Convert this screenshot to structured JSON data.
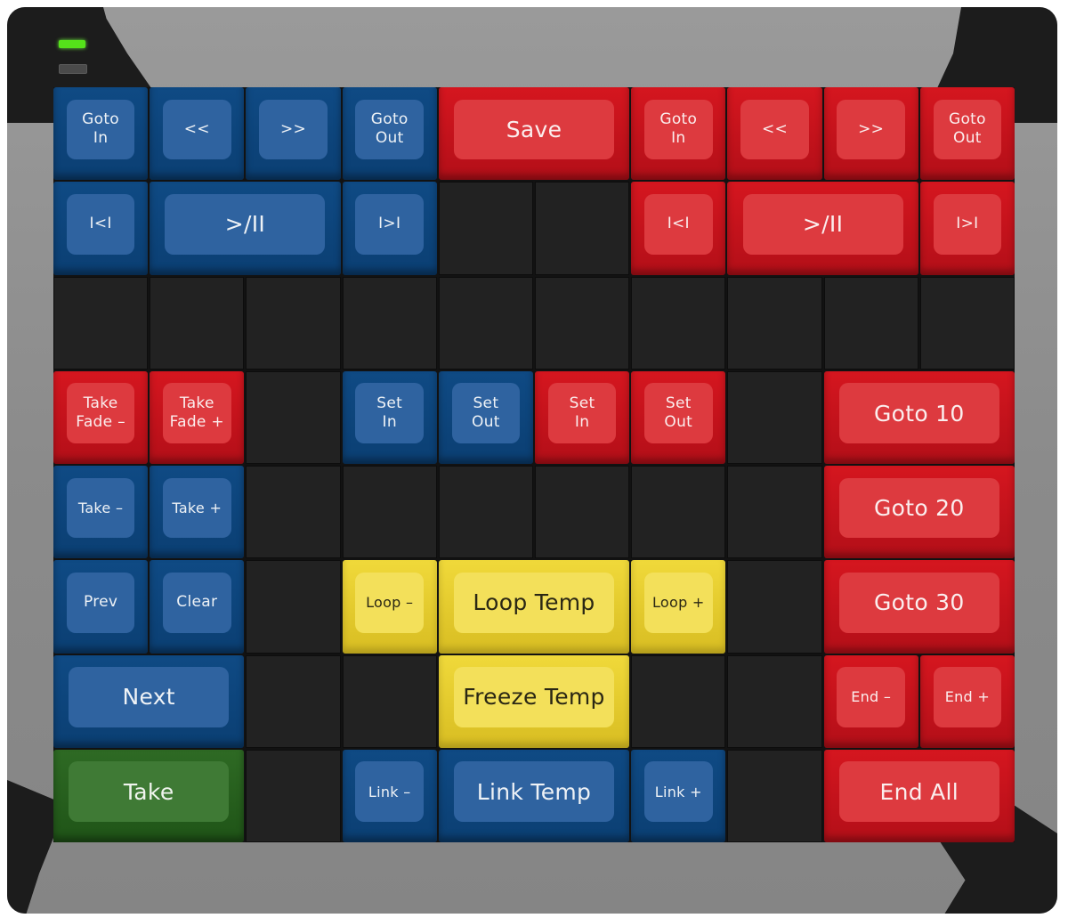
{
  "device": {
    "leds": [
      {
        "name": "power-led",
        "state": "on",
        "color": "#55e21a"
      },
      {
        "name": "status-led",
        "state": "off",
        "color": "#4a4a4a"
      }
    ],
    "colors": {
      "blue": "#2f63a0",
      "red": "#dd3a3f",
      "yellow": "#f3e05a",
      "green": "#3f7a35",
      "blank": "#222222"
    }
  },
  "keys": [
    {
      "id": "goto-in-left",
      "label": "Goto\nIn",
      "color": "blue",
      "col": 1,
      "row": 1,
      "w": 1,
      "h": 1
    },
    {
      "id": "rewind-left",
      "label": "<<",
      "color": "blue",
      "col": 2,
      "row": 1,
      "w": 1,
      "h": 1
    },
    {
      "id": "fast-forward-left",
      "label": ">>",
      "color": "blue",
      "col": 3,
      "row": 1,
      "w": 1,
      "h": 1
    },
    {
      "id": "goto-out-left",
      "label": "Goto\nOut",
      "color": "blue",
      "col": 4,
      "row": 1,
      "w": 1,
      "h": 1
    },
    {
      "id": "save",
      "label": "Save",
      "color": "red",
      "col": 5,
      "row": 1,
      "w": 2,
      "h": 1
    },
    {
      "id": "goto-in-right",
      "label": "Goto\nIn",
      "color": "red",
      "col": 7,
      "row": 1,
      "w": 1,
      "h": 1
    },
    {
      "id": "rewind-right",
      "label": "<<",
      "color": "red",
      "col": 8,
      "row": 1,
      "w": 1,
      "h": 1
    },
    {
      "id": "fast-forward-right",
      "label": ">>",
      "color": "red",
      "col": 9,
      "row": 1,
      "w": 1,
      "h": 1
    },
    {
      "id": "goto-out-right",
      "label": "Goto\nOut",
      "color": "red",
      "col": 10,
      "row": 1,
      "w": 1,
      "h": 1
    },
    {
      "id": "skip-back-left",
      "label": "I<I",
      "color": "blue",
      "col": 1,
      "row": 2,
      "w": 1,
      "h": 1
    },
    {
      "id": "play-pause-left",
      "label": ">/II",
      "color": "blue",
      "col": 2,
      "row": 2,
      "w": 2,
      "h": 1
    },
    {
      "id": "skip-forward-left",
      "label": "I>I",
      "color": "blue",
      "col": 4,
      "row": 2,
      "w": 1,
      "h": 1
    },
    {
      "id": "skip-back-right",
      "label": "I<I",
      "color": "red",
      "col": 7,
      "row": 2,
      "w": 1,
      "h": 1
    },
    {
      "id": "play-pause-right",
      "label": ">/II",
      "color": "red",
      "col": 8,
      "row": 2,
      "w": 2,
      "h": 1
    },
    {
      "id": "skip-forward-right",
      "label": "I>I",
      "color": "red",
      "col": 10,
      "row": 2,
      "w": 1,
      "h": 1
    },
    {
      "id": "take-fade-minus",
      "label": "Take\nFade –",
      "color": "red",
      "col": 1,
      "row": 4,
      "w": 1,
      "h": 1
    },
    {
      "id": "take-fade-plus",
      "label": "Take\nFade +",
      "color": "red",
      "col": 2,
      "row": 4,
      "w": 1,
      "h": 1
    },
    {
      "id": "set-in-blue",
      "label": "Set\nIn",
      "color": "blue",
      "col": 4,
      "row": 4,
      "w": 1,
      "h": 1
    },
    {
      "id": "set-out-blue",
      "label": "Set\nOut",
      "color": "blue",
      "col": 5,
      "row": 4,
      "w": 1,
      "h": 1
    },
    {
      "id": "set-in-red",
      "label": "Set\nIn",
      "color": "red",
      "col": 6,
      "row": 4,
      "w": 1,
      "h": 1
    },
    {
      "id": "set-out-red",
      "label": "Set\nOut",
      "color": "red",
      "col": 7,
      "row": 4,
      "w": 1,
      "h": 1
    },
    {
      "id": "goto-10",
      "label": "Goto 10",
      "color": "red",
      "col": 9,
      "row": 4,
      "w": 2,
      "h": 1
    },
    {
      "id": "take-minus",
      "label": "Take –",
      "color": "blue",
      "col": 1,
      "row": 5,
      "w": 1,
      "h": 1
    },
    {
      "id": "take-plus",
      "label": "Take +",
      "color": "blue",
      "col": 2,
      "row": 5,
      "w": 1,
      "h": 1
    },
    {
      "id": "goto-20",
      "label": "Goto 20",
      "color": "red",
      "col": 9,
      "row": 5,
      "w": 2,
      "h": 1
    },
    {
      "id": "prev",
      "label": "Prev",
      "color": "blue",
      "col": 1,
      "row": 6,
      "w": 1,
      "h": 1
    },
    {
      "id": "clear",
      "label": "Clear",
      "color": "blue",
      "col": 2,
      "row": 6,
      "w": 1,
      "h": 1
    },
    {
      "id": "loop-minus",
      "label": "Loop –",
      "color": "yellow",
      "col": 4,
      "row": 6,
      "w": 1,
      "h": 1
    },
    {
      "id": "loop-temp",
      "label": "Loop Temp",
      "color": "yellow",
      "col": 5,
      "row": 6,
      "w": 2,
      "h": 1
    },
    {
      "id": "loop-plus",
      "label": "Loop +",
      "color": "yellow",
      "col": 7,
      "row": 6,
      "w": 1,
      "h": 1
    },
    {
      "id": "goto-30",
      "label": "Goto 30",
      "color": "red",
      "col": 9,
      "row": 6,
      "w": 2,
      "h": 1
    },
    {
      "id": "next",
      "label": "Next",
      "color": "blue",
      "col": 1,
      "row": 7,
      "w": 2,
      "h": 1
    },
    {
      "id": "freeze-temp",
      "label": "Freeze Temp",
      "color": "yellow",
      "col": 5,
      "row": 7,
      "w": 2,
      "h": 1
    },
    {
      "id": "end-minus",
      "label": "End –",
      "color": "red",
      "col": 9,
      "row": 7,
      "w": 1,
      "h": 1
    },
    {
      "id": "end-plus",
      "label": "End +",
      "color": "red",
      "col": 10,
      "row": 7,
      "w": 1,
      "h": 1
    },
    {
      "id": "take",
      "label": "Take",
      "color": "green",
      "col": 1,
      "row": 8,
      "w": 2,
      "h": 1
    },
    {
      "id": "link-minus",
      "label": "Link –",
      "color": "blue",
      "col": 4,
      "row": 8,
      "w": 1,
      "h": 1
    },
    {
      "id": "link-temp",
      "label": "Link Temp",
      "color": "blue",
      "col": 5,
      "row": 8,
      "w": 2,
      "h": 1
    },
    {
      "id": "link-plus",
      "label": "Link +",
      "color": "blue",
      "col": 7,
      "row": 8,
      "w": 1,
      "h": 1
    },
    {
      "id": "end-all",
      "label": "End All",
      "color": "red",
      "col": 9,
      "row": 8,
      "w": 2,
      "h": 1
    }
  ]
}
